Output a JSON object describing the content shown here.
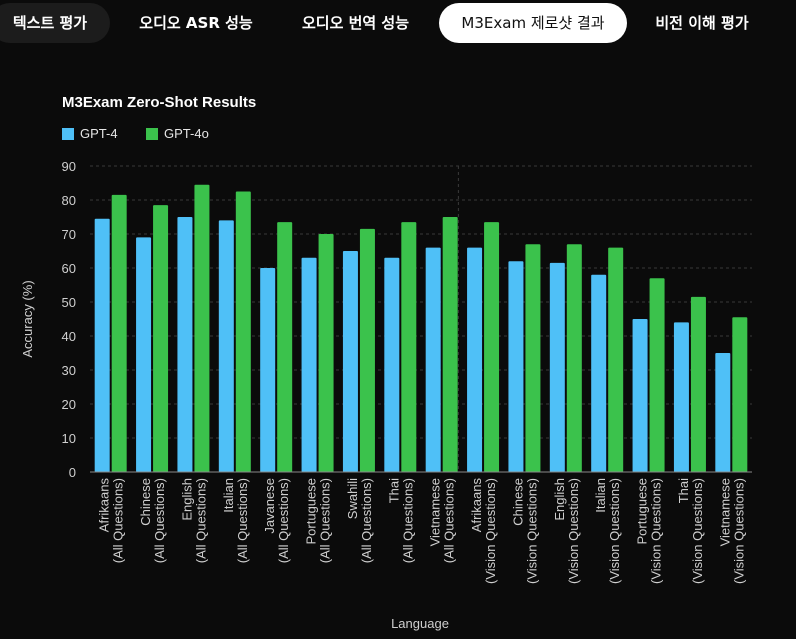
{
  "tabs": [
    {
      "label": "텍스트 평가",
      "active": false
    },
    {
      "label": "오디오 ASR 성능",
      "active": false
    },
    {
      "label": "오디오 번역 성능",
      "active": false
    },
    {
      "label": "M3Exam 제로샷 결과",
      "active": true
    },
    {
      "label": "비전 이해 평가",
      "active": false
    }
  ],
  "colors": {
    "background": "#0b0b0b",
    "gpt4": "#4fc0f7",
    "gpt4o": "#3bc24c",
    "grid": "#3a3a3a",
    "active_tab_bg": "#ffffff"
  },
  "chart_data": {
    "type": "bar",
    "title": "M3Exam Zero-Shot Results",
    "xlabel": "Language",
    "ylabel": "Accuracy (%)",
    "ylim": [
      0,
      90
    ],
    "yticks": [
      0,
      10,
      20,
      30,
      40,
      50,
      60,
      70,
      80,
      90
    ],
    "grid": true,
    "legend_position": "top-left",
    "categories": [
      [
        "Afrikaans",
        "(All Questions)"
      ],
      [
        "Chinese",
        "(All Questions)"
      ],
      [
        "English",
        "(All Questions)"
      ],
      [
        "Italian",
        "(All Questions)"
      ],
      [
        "Javanese",
        "(All Questions)"
      ],
      [
        "Portuguese",
        "(All Questions)"
      ],
      [
        "Swahili",
        "(All Questions)"
      ],
      [
        "Thai",
        "(All Questions)"
      ],
      [
        "Vietnamese",
        "(All Questions)"
      ],
      [
        "Afrikaans",
        "(Vision Questions)"
      ],
      [
        "Chinese",
        "(Vision Questions)"
      ],
      [
        "English",
        "(Vision Questions)"
      ],
      [
        "Italian",
        "(Vision Questions)"
      ],
      [
        "Portuguese",
        "(Vision Questions)"
      ],
      [
        "Thai",
        "(Vision Questions)"
      ],
      [
        "Vietnamese",
        "(Vision Questions)"
      ]
    ],
    "series": [
      {
        "name": "GPT-4",
        "color": "#4fc0f7",
        "values": [
          74.5,
          69,
          75,
          74,
          60,
          63,
          65,
          63,
          66,
          66,
          62,
          61.5,
          58,
          45,
          44,
          35
        ]
      },
      {
        "name": "GPT-4o",
        "color": "#3bc24c",
        "values": [
          81.5,
          78.5,
          84.5,
          82.5,
          73.5,
          70,
          71.5,
          73.5,
          75,
          73.5,
          67,
          67,
          66,
          57,
          51.5,
          45.5
        ]
      }
    ]
  }
}
